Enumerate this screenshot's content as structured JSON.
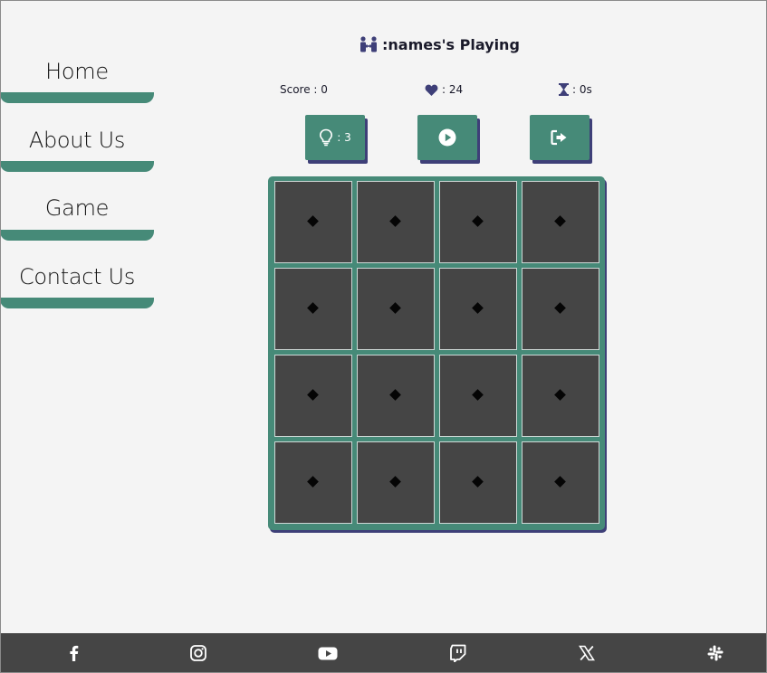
{
  "sidebar": {
    "items": [
      {
        "label": "Home"
      },
      {
        "label": "About Us"
      },
      {
        "label": "Game"
      },
      {
        "label": "Contact Us"
      }
    ]
  },
  "header": {
    "title": ":names's Playing",
    "icon": "players-icon"
  },
  "stats": {
    "score": "Score : 0",
    "lives": ": 24",
    "time": ": 0s"
  },
  "actions": {
    "hint_count": ": 3",
    "play": "play-icon",
    "exit": "sign-out-icon"
  },
  "board": {
    "rows": 4,
    "cols": 4,
    "card_symbol": "diamond"
  },
  "footer": {
    "links": [
      "facebook",
      "instagram",
      "youtube",
      "twitch",
      "x",
      "slack"
    ]
  },
  "colors": {
    "accent": "#468a78",
    "shadow": "#3e3f78",
    "card": "#454545",
    "footer": "#454545",
    "background": "#f4f4f4"
  }
}
